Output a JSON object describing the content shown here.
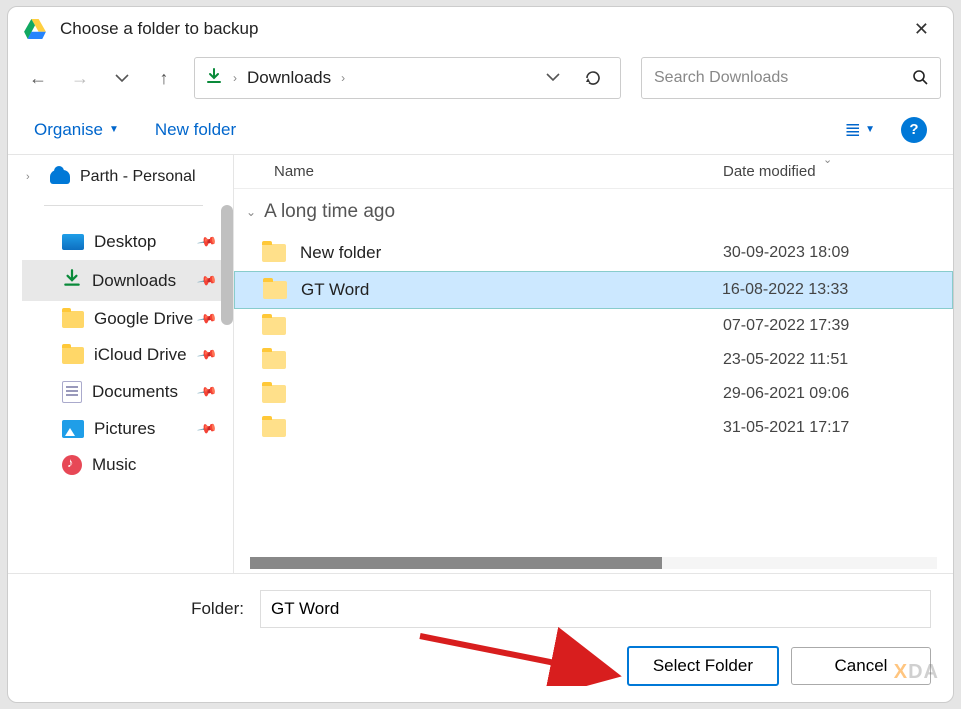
{
  "title": "Choose a folder to backup",
  "breadcrumb": {
    "location": "Downloads"
  },
  "search": {
    "placeholder": "Search Downloads"
  },
  "toolbar": {
    "organise": "Organise",
    "new_folder": "New folder"
  },
  "sidebar": {
    "top": "Parth - Personal",
    "items": [
      {
        "label": "Desktop"
      },
      {
        "label": "Downloads"
      },
      {
        "label": "Google Drive"
      },
      {
        "label": "iCloud Drive"
      },
      {
        "label": "Documents"
      },
      {
        "label": "Pictures"
      },
      {
        "label": "Music"
      }
    ]
  },
  "columns": {
    "name": "Name",
    "date": "Date modified"
  },
  "group": {
    "label": "A long time ago"
  },
  "rows": [
    {
      "name": "New folder",
      "date": "30-09-2023 18:09"
    },
    {
      "name": "GT Word",
      "date": "16-08-2022 13:33"
    },
    {
      "name": "",
      "date": "07-07-2022 17:39"
    },
    {
      "name": "",
      "date": "23-05-2022 11:51"
    },
    {
      "name": "",
      "date": "29-06-2021 09:06"
    },
    {
      "name": "",
      "date": "31-05-2021 17:17"
    }
  ],
  "footer": {
    "folder_label": "Folder:",
    "folder_value": "GT Word",
    "select": "Select Folder",
    "cancel": "Cancel"
  },
  "watermark": {
    "left": "",
    "x": "X",
    "right": "DA"
  }
}
